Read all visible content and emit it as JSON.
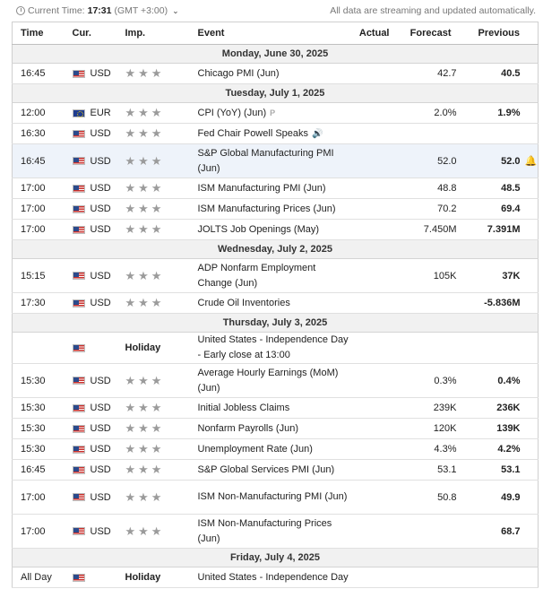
{
  "header": {
    "time_label": "Current Time:",
    "time_value": "17:31",
    "timezone": "(GMT +3:00)",
    "status_text": "All data are streaming and updated automatically."
  },
  "columns": {
    "time": "Time",
    "cur": "Cur.",
    "imp": "Imp.",
    "event": "Event",
    "actual": "Actual",
    "forecast": "Forecast",
    "previous": "Previous"
  },
  "days": [
    {
      "label": "Monday, June 30, 2025",
      "events": [
        {
          "time": "16:45",
          "flag": "us",
          "cur": "USD",
          "stars": "★★★",
          "event": "Chicago PMI (Jun)",
          "actual": "",
          "forecast": "42.7",
          "previous": "40.5",
          "tall": false
        }
      ]
    },
    {
      "label": "Tuesday, July 1, 2025",
      "events": [
        {
          "time": "12:00",
          "flag": "eu",
          "cur": "EUR",
          "stars": "★★★",
          "event": "CPI (YoY) (Jun)",
          "prelim": "P",
          "actual": "",
          "forecast": "2.0%",
          "previous": "1.9%",
          "tall": false
        },
        {
          "time": "16:30",
          "flag": "us",
          "cur": "USD",
          "stars": "★★★",
          "event": "Fed Chair Powell Speaks",
          "speaker": true,
          "actual": "",
          "forecast": "",
          "previous": "",
          "tall": false
        },
        {
          "time": "16:45",
          "flag": "us",
          "cur": "USD",
          "stars": "★★★",
          "event": "S&P Global Manufacturing PMI (Jun)",
          "actual": "",
          "forecast": "52.0",
          "previous": "52.0",
          "tall": true,
          "highlight": true,
          "bell": true
        },
        {
          "time": "17:00",
          "flag": "us",
          "cur": "USD",
          "stars": "★★★",
          "event": "ISM Manufacturing PMI (Jun)",
          "actual": "",
          "forecast": "48.8",
          "previous": "48.5",
          "tall": false
        },
        {
          "time": "17:00",
          "flag": "us",
          "cur": "USD",
          "stars": "★★★",
          "event": "ISM Manufacturing Prices (Jun)",
          "actual": "",
          "forecast": "70.2",
          "previous": "69.4",
          "tall": false
        },
        {
          "time": "17:00",
          "flag": "us",
          "cur": "USD",
          "stars": "★★★",
          "event": "JOLTS Job Openings (May)",
          "actual": "",
          "forecast": "7.450M",
          "previous": "7.391M",
          "tall": false
        }
      ]
    },
    {
      "label": "Wednesday, July 2, 2025",
      "events": [
        {
          "time": "15:15",
          "flag": "us",
          "cur": "USD",
          "stars": "★★★",
          "event": "ADP Nonfarm Employment Change (Jun)",
          "actual": "",
          "forecast": "105K",
          "previous": "37K",
          "tall": true
        },
        {
          "time": "17:30",
          "flag": "us",
          "cur": "USD",
          "stars": "★★★",
          "event": "Crude Oil Inventories",
          "actual": "",
          "forecast": "",
          "previous": "-5.836M",
          "tall": false
        }
      ]
    },
    {
      "label": "Thursday, July 3, 2025",
      "events": [
        {
          "time": "",
          "flag": "us",
          "cur": "",
          "holiday": "Holiday",
          "event": "United States - Independence Day - Early close at 13:00",
          "actual": "",
          "forecast": "",
          "previous": "",
          "tall": false
        },
        {
          "time": "15:30",
          "flag": "us",
          "cur": "USD",
          "stars": "★★★",
          "event": "Average Hourly Earnings (MoM) (Jun)",
          "actual": "",
          "forecast": "0.3%",
          "previous": "0.4%",
          "tall": true
        },
        {
          "time": "15:30",
          "flag": "us",
          "cur": "USD",
          "stars": "★★★",
          "event": "Initial Jobless Claims",
          "actual": "",
          "forecast": "239K",
          "previous": "236K",
          "tall": false
        },
        {
          "time": "15:30",
          "flag": "us",
          "cur": "USD",
          "stars": "★★★",
          "event": "Nonfarm Payrolls (Jun)",
          "actual": "",
          "forecast": "120K",
          "previous": "139K",
          "tall": false
        },
        {
          "time": "15:30",
          "flag": "us",
          "cur": "USD",
          "stars": "★★★",
          "event": "Unemployment Rate (Jun)",
          "actual": "",
          "forecast": "4.3%",
          "previous": "4.2%",
          "tall": false
        },
        {
          "time": "16:45",
          "flag": "us",
          "cur": "USD",
          "stars": "★★★",
          "event": "S&P Global Services PMI (Jun)",
          "actual": "",
          "forecast": "53.1",
          "previous": "53.1",
          "tall": false
        },
        {
          "time": "17:00",
          "flag": "us",
          "cur": "USD",
          "stars": "★★★",
          "event": "ISM Non-Manufacturing PMI (Jun)",
          "actual": "",
          "forecast": "50.8",
          "previous": "49.9",
          "tall": true
        },
        {
          "time": "17:00",
          "flag": "us",
          "cur": "USD",
          "stars": "★★★",
          "event": "ISM Non-Manufacturing Prices (Jun)",
          "actual": "",
          "forecast": "",
          "previous": "68.7",
          "tall": true
        }
      ]
    },
    {
      "label": "Friday, July 4, 2025",
      "events": [
        {
          "time": "All Day",
          "flag": "us",
          "cur": "",
          "holiday": "Holiday",
          "event": "United States - Independence Day",
          "actual": "",
          "forecast": "",
          "previous": "",
          "tall": false
        }
      ]
    }
  ]
}
